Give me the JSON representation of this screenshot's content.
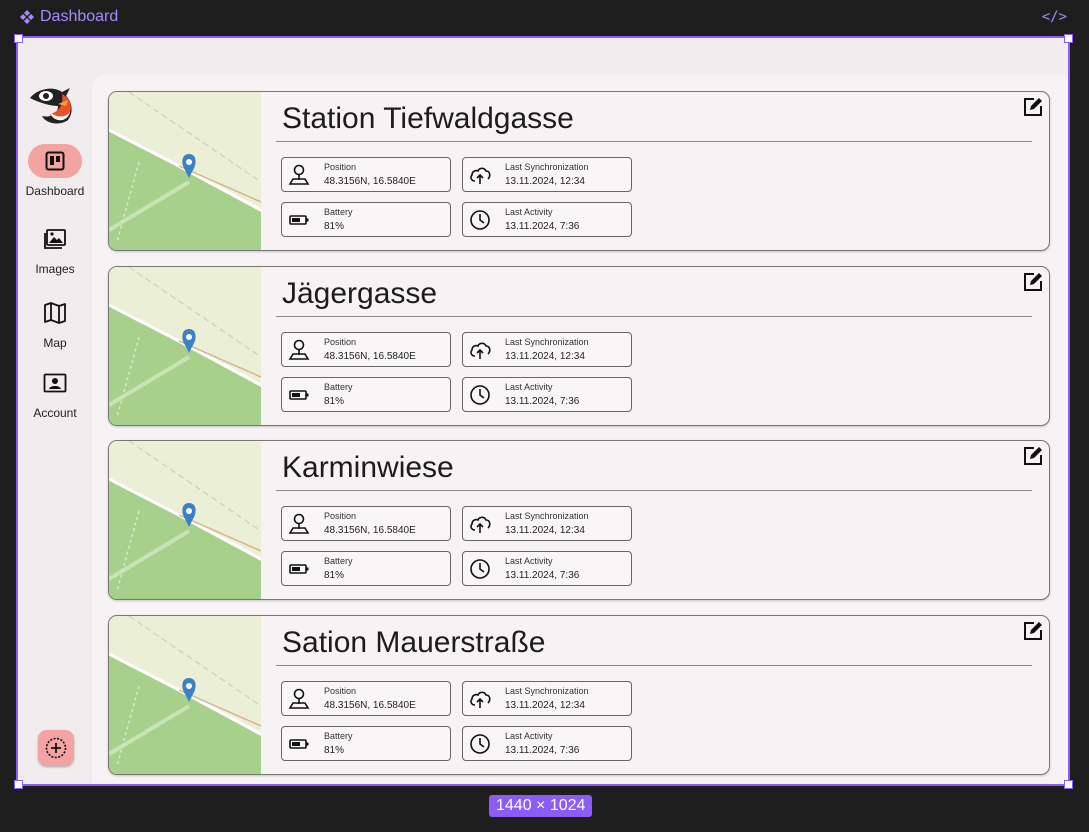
{
  "frame": {
    "title": "Dashboard",
    "size_label": "1440 × 1024"
  },
  "sidebar": {
    "items": [
      {
        "label": "Dashboard",
        "icon": "dashboard-icon",
        "active": true
      },
      {
        "label": "Images",
        "icon": "images-icon",
        "active": false
      },
      {
        "label": "Map",
        "icon": "map-icon",
        "active": false
      },
      {
        "label": "Account",
        "icon": "account-icon",
        "active": false
      }
    ],
    "add_icon": "add-icon"
  },
  "labels": {
    "position": "Position",
    "last_sync": "Last Synchronization",
    "battery": "Battery",
    "last_activity": "Last Activity"
  },
  "stations": [
    {
      "name": "Station Tiefwaldgasse",
      "position": "48.3156N, 16.5840E",
      "last_sync": "13.11.2024, 12:34",
      "battery": "81%",
      "last_activity": "13.11.2024, 7:36"
    },
    {
      "name": "Jägergasse",
      "position": "48.3156N, 16.5840E",
      "last_sync": "13.11.2024, 12:34",
      "battery": "81%",
      "last_activity": "13.11.2024, 7:36"
    },
    {
      "name": "Karminwiese",
      "position": "48.3156N, 16.5840E",
      "last_sync": "13.11.2024, 12:34",
      "battery": "81%",
      "last_activity": "13.11.2024, 7:36"
    },
    {
      "name": "Sation Mauerstraße",
      "position": "48.3156N, 16.5840E",
      "last_sync": "13.11.2024, 12:34",
      "battery": "81%",
      "last_activity": "13.11.2024, 7:36"
    }
  ],
  "colors": {
    "accent": "#8b5cf6",
    "active_nav": "#f4a3a3",
    "map_green": "#a8d08d",
    "map_light": "#eaefd6",
    "pin": "#3b82c4"
  }
}
